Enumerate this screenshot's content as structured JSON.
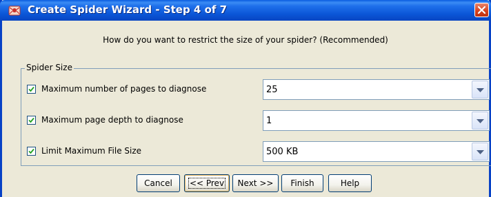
{
  "window": {
    "title": "Create Spider Wizard - Step 4 of 7",
    "title_bar_color": "#0A55D6"
  },
  "question": "How do you want to restrict the size of your spider? (Recommended)",
  "group": {
    "legend": "Spider Size",
    "options": [
      {
        "label": "Maximum number of pages to diagnose",
        "checked": true,
        "value": "25"
      },
      {
        "label": "Maximum page depth to diagnose",
        "checked": true,
        "value": "1"
      },
      {
        "label": "Limit Maximum File Size",
        "checked": true,
        "value": "500 KB"
      }
    ]
  },
  "buttons": {
    "cancel": "Cancel",
    "prev": "<< Prev",
    "next": "Next >>",
    "finish": "Finish",
    "help": "Help"
  },
  "icons": {
    "app": "spider-app-icon",
    "close": "close-icon",
    "dropdown": "chevron-down-icon",
    "check": "check-icon"
  }
}
